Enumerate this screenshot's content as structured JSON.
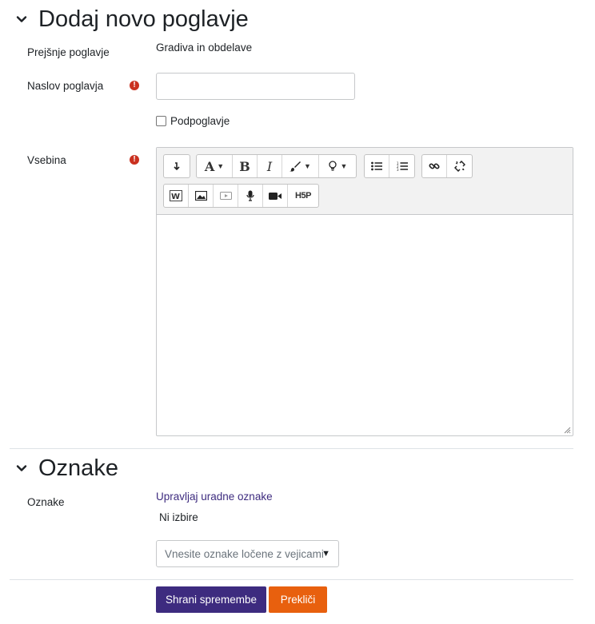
{
  "section1": {
    "title": "Dodaj novo poglavje",
    "prev_label": "Prejšnje poglavje",
    "prev_value": "Gradiva in obdelave",
    "title_label": "Naslov poglavja",
    "title_value": "",
    "sub_label": "Podpoglavje",
    "content_label": "Vsebina",
    "content_value": ""
  },
  "toolbar": {
    "row1": [
      "collapse-icon",
      "font-style-icon",
      "bold-icon",
      "italic-icon",
      "brush-icon",
      "lightbulb-icon",
      "unordered-list-icon",
      "ordered-list-icon",
      "link-icon",
      "unlink-icon"
    ],
    "row2": [
      "word-paste-icon",
      "image-icon",
      "media-icon",
      "record-audio-icon",
      "record-video-icon",
      "h5p-icon"
    ],
    "font_glyph": "A",
    "bold_glyph": "B",
    "italic_glyph": "I",
    "h5p_glyph": "H5P"
  },
  "section2": {
    "title": "Oznake",
    "tags_label": "Oznake",
    "manage_link": "Upravljaj uradne oznake",
    "no_selection": "Ni izbire",
    "placeholder": "Vnesite oznake ločene z vejicami"
  },
  "buttons": {
    "save": "Shrani spremembe",
    "cancel": "Prekliči"
  },
  "colors": {
    "primary": "#3d2b7f",
    "cancel": "#e8600e",
    "required": "#ca3120"
  }
}
